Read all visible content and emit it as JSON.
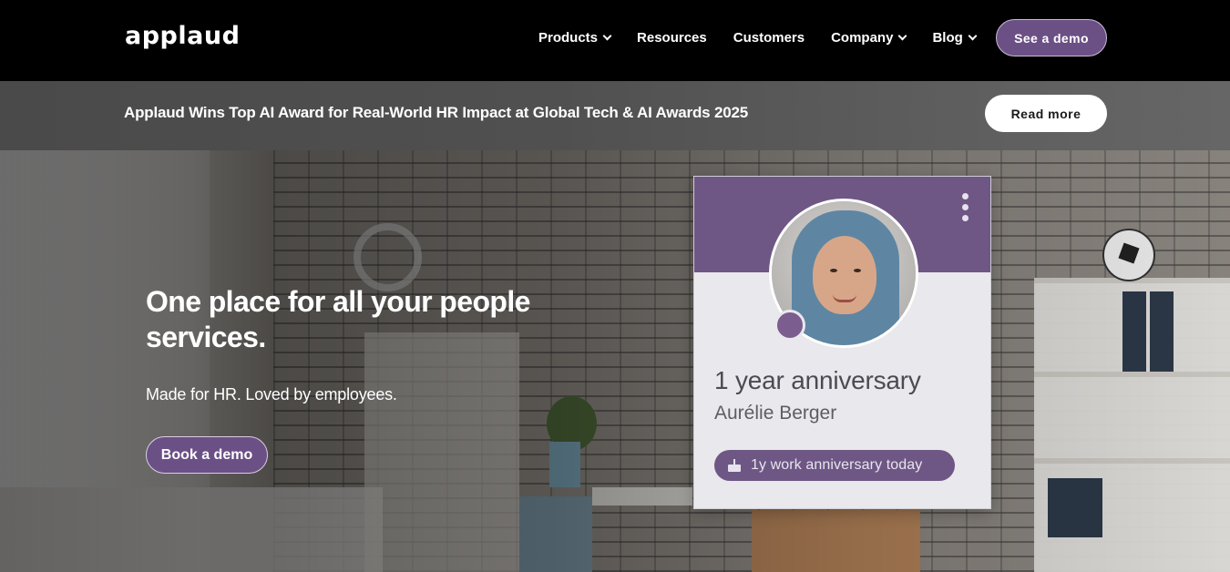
{
  "nav": {
    "logo": "applaud",
    "items": [
      {
        "label": "Products",
        "has_dropdown": true
      },
      {
        "label": "Resources",
        "has_dropdown": false
      },
      {
        "label": "Customers",
        "has_dropdown": false
      },
      {
        "label": "Company",
        "has_dropdown": true
      },
      {
        "label": "Blog",
        "has_dropdown": true
      }
    ],
    "cta": "See a demo"
  },
  "banner": {
    "text": "Applaud Wins Top AI Award for Real-World HR Impact at Global Tech & AI Awards 2025",
    "button": "Read more"
  },
  "hero": {
    "title": "One place for all your people services.",
    "subtitle": "Made for HR. Loved by employees.",
    "cta": "Book a demo"
  },
  "card": {
    "title": "1 year anniversary",
    "name": "Aurélie Berger",
    "pill": "1y work anniversary today"
  },
  "colors": {
    "brand_purple": "#6b5085",
    "nav_bg": "#000000",
    "banner_bg": "#505050"
  },
  "icons": [
    "chevron-down-icon",
    "more-vertical-icon",
    "cake-icon"
  ]
}
